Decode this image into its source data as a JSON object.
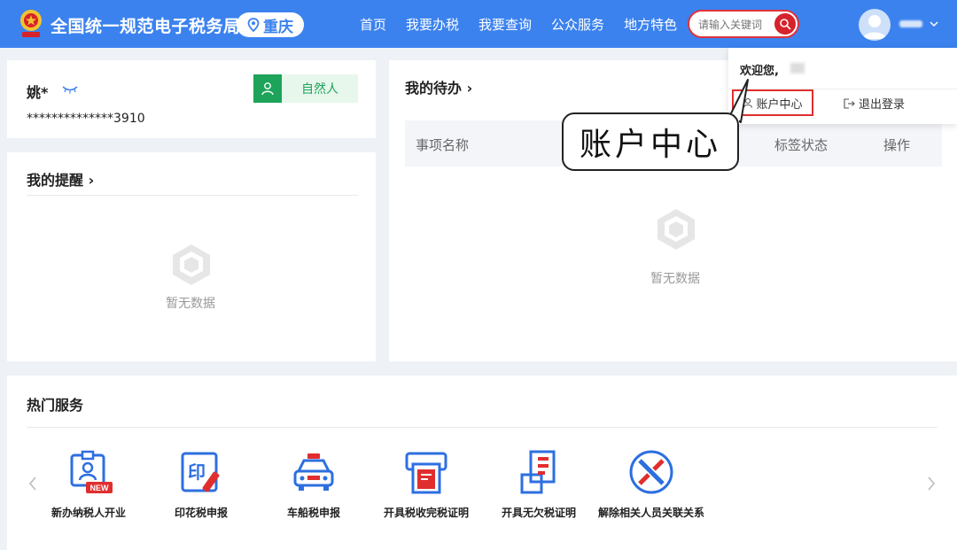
{
  "header": {
    "site_title": "全国统一规范电子税务局",
    "region": "重庆",
    "nav": [
      "首页",
      "我要办税",
      "我要查询",
      "公众服务",
      "地方特色"
    ],
    "search_placeholder": "请输入关键词"
  },
  "user_card": {
    "name": "姚*",
    "id_masked": "**************3910",
    "type": "自然人"
  },
  "reminders": {
    "title": "我的提醒",
    "empty_text": "暂无数据"
  },
  "todo": {
    "title": "我的待办",
    "columns": [
      "事项名称",
      "标签状态",
      "操作"
    ],
    "empty_text": "暂无数据"
  },
  "dropdown": {
    "welcome": "欢迎您,",
    "account_center": "账户中心",
    "logout": "退出登录"
  },
  "callout": "账户中心",
  "hot_services": {
    "title": "热门服务",
    "items": [
      {
        "label": "新办纳税人开业",
        "icon": "new-taxpayer-icon"
      },
      {
        "label": "印花税申报",
        "icon": "stamp-tax-icon"
      },
      {
        "label": "车船税申报",
        "icon": "vehicle-tax-icon"
      },
      {
        "label": "开具税收完税证明",
        "icon": "tax-certificate-icon"
      },
      {
        "label": "开具无欠税证明",
        "icon": "no-arrears-icon"
      },
      {
        "label": "解除相关人员关联关系",
        "icon": "unlink-icon"
      }
    ],
    "badge_new": "NEW",
    "stamp_char": "印"
  },
  "colors": {
    "header_blue": "#3b82ee",
    "accent_red": "#e02e2e",
    "green": "#1da45a"
  }
}
